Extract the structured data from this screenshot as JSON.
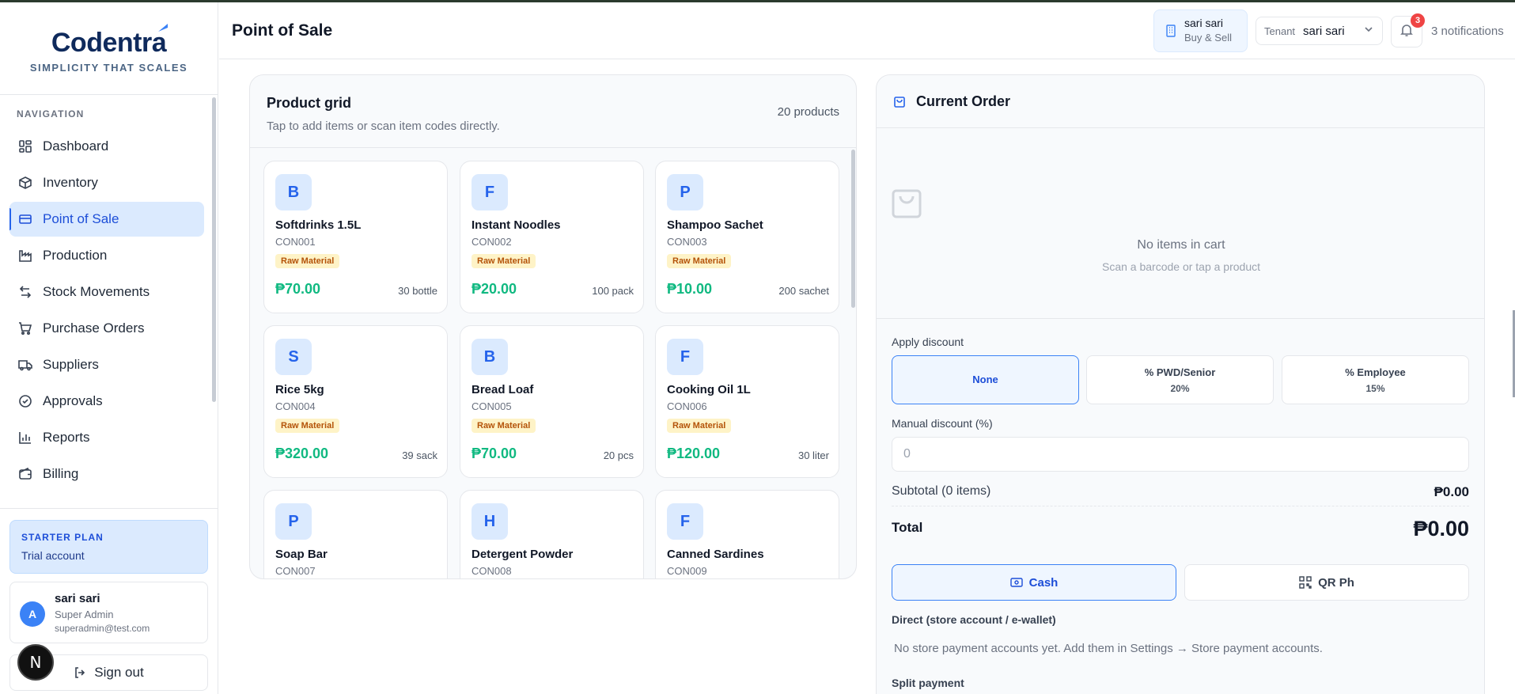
{
  "brand": {
    "name": "Codentra",
    "tagline": "SIMPLICITY THAT SCALES"
  },
  "sidebar": {
    "nav_title": "NAVIGATION",
    "items": [
      {
        "label": "Dashboard",
        "icon": "dashboard-icon"
      },
      {
        "label": "Inventory",
        "icon": "box-icon"
      },
      {
        "label": "Point of Sale",
        "icon": "card-icon",
        "active": true
      },
      {
        "label": "Production",
        "icon": "factory-icon"
      },
      {
        "label": "Stock Movements",
        "icon": "arrows-icon"
      },
      {
        "label": "Purchase Orders",
        "icon": "cart-icon"
      },
      {
        "label": "Suppliers",
        "icon": "truck-icon"
      },
      {
        "label": "Approvals",
        "icon": "check-circle-icon"
      },
      {
        "label": "Reports",
        "icon": "bar-chart-icon"
      },
      {
        "label": "Billing",
        "icon": "wallet-icon"
      }
    ],
    "plan": {
      "title": "STARTER PLAN",
      "subtitle": "Trial account"
    },
    "user": {
      "initial": "A",
      "name": "sari sari",
      "role": "Super Admin",
      "email": "superadmin@test.com"
    },
    "signout_label": "Sign out",
    "floating_badge": "N"
  },
  "header": {
    "title": "Point of Sale",
    "store": {
      "name": "sari sari",
      "subtitle": "Buy & Sell"
    },
    "tenant": {
      "label": "Tenant",
      "value": "sari sari"
    },
    "notifications": {
      "count": "3",
      "text": "3 notifications"
    }
  },
  "product_grid": {
    "title": "Product grid",
    "subtitle": "Tap to add items or scan item codes directly.",
    "count_label": "20 products",
    "products": [
      {
        "initial": "B",
        "name": "Softdrinks 1.5L",
        "code": "CON001",
        "badge": "Raw Material",
        "price": "₱70.00",
        "stock": "30 bottle"
      },
      {
        "initial": "F",
        "name": "Instant Noodles",
        "code": "CON002",
        "badge": "Raw Material",
        "price": "₱20.00",
        "stock": "100 pack"
      },
      {
        "initial": "P",
        "name": "Shampoo Sachet",
        "code": "CON003",
        "badge": "Raw Material",
        "price": "₱10.00",
        "stock": "200 sachet"
      },
      {
        "initial": "S",
        "name": "Rice 5kg",
        "code": "CON004",
        "badge": "Raw Material",
        "price": "₱320.00",
        "stock": "39 sack"
      },
      {
        "initial": "B",
        "name": "Bread Loaf",
        "code": "CON005",
        "badge": "Raw Material",
        "price": "₱70.00",
        "stock": "20 pcs"
      },
      {
        "initial": "F",
        "name": "Cooking Oil 1L",
        "code": "CON006",
        "badge": "Raw Material",
        "price": "₱120.00",
        "stock": "30 liter"
      },
      {
        "initial": "P",
        "name": "Soap Bar",
        "code": "CON007",
        "badge": "",
        "price": "",
        "stock": ""
      },
      {
        "initial": "H",
        "name": "Detergent Powder",
        "code": "CON008",
        "badge": "",
        "price": "",
        "stock": ""
      },
      {
        "initial": "F",
        "name": "Canned Sardines",
        "code": "CON009",
        "badge": "",
        "price": "",
        "stock": ""
      }
    ]
  },
  "order": {
    "title": "Current Order",
    "empty_title": "No items in cart",
    "empty_sub": "Scan a barcode or tap a product",
    "discount_label": "Apply discount",
    "discounts": [
      {
        "title": "None",
        "sub": ""
      },
      {
        "title": "% PWD/Senior",
        "sub": "20%"
      },
      {
        "title": "% Employee",
        "sub": "15%"
      }
    ],
    "manual_label": "Manual discount (%)",
    "manual_placeholder": "0",
    "subtotal_label": "Subtotal (0 items)",
    "subtotal_value": "₱0.00",
    "total_label": "Total",
    "total_value": "₱0.00",
    "payment": {
      "cash": "Cash",
      "qr": "QR Ph"
    },
    "direct_label": "Direct (store account / e-wallet)",
    "direct_note": "No store payment accounts yet. Add them in Settings → Store payment accounts.",
    "split_label": "Split payment"
  }
}
